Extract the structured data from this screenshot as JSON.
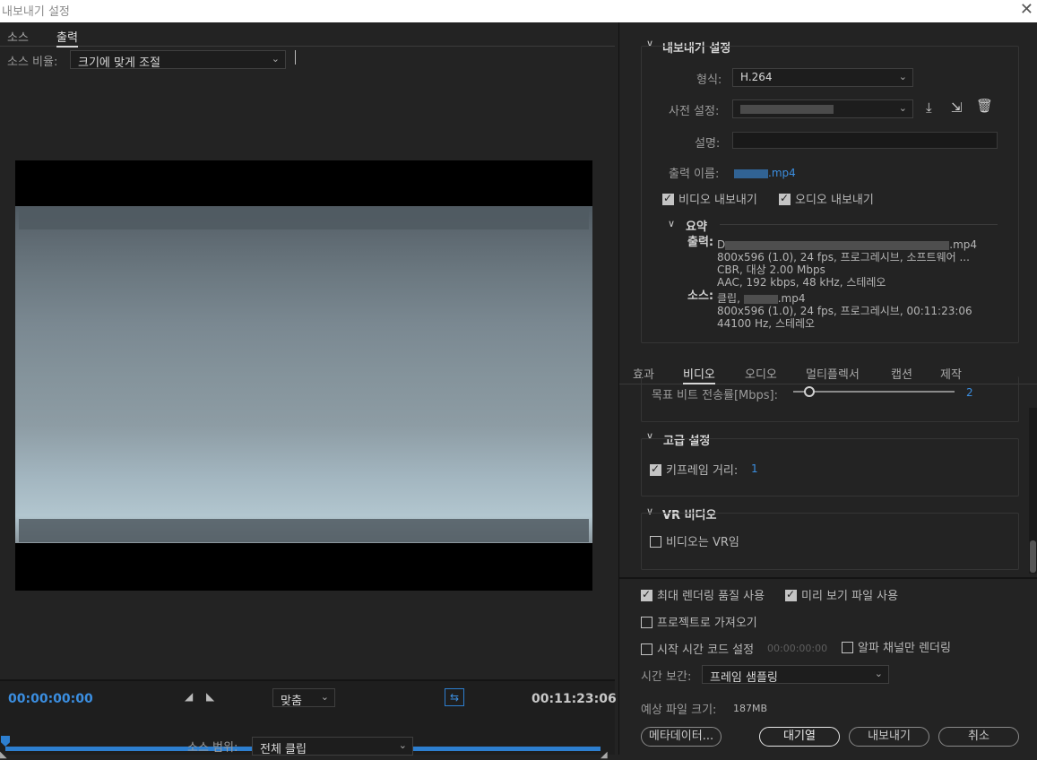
{
  "window": {
    "title": "내보내기 설정"
  },
  "left": {
    "tabs": [
      "소스",
      "출력"
    ],
    "source_scaling_label": "소스 비율:",
    "source_scaling_value": "크기에 맞게 조절",
    "timecode_start": "00:00:00:00",
    "timecode_end": "00:11:23:06",
    "fit_value": "맞춤",
    "source_range_label": "소스 범위:",
    "source_range_value": "전체 클립"
  },
  "export_settings": {
    "header": "내보내기 설정",
    "format_label": "형식:",
    "format_value": "H.264",
    "preset_label": "사전 설정:",
    "comment_label": "설명:",
    "output_name_label": "출력 이름:",
    "output_name_value": ".mp4",
    "export_video_label": "비디오 내보내기",
    "export_audio_label": "오디오 내보내기",
    "summary_header": "요약",
    "output_label": "출력:",
    "output_line1_prefix": "D",
    "output_line1_suffix": ".mp4",
    "output_line2": "800x596 (1.0), 24 fps, 프로그레시브, 소프트웨어 ...",
    "output_line3": "CBR, 대상 2.00 Mbps",
    "output_line4": "AAC, 192 kbps, 48 kHz, 스테레오",
    "source_label": "소스:",
    "source_line1_prefix": "클립, ",
    "source_line1_suffix": ".mp4",
    "source_line2": "800x596 (1.0), 24 fps, 프로그레시브, 00:11:23:06",
    "source_line3": "44100 Hz, 스테레오"
  },
  "settings_tabs": [
    "효과",
    "비디오",
    "오디오",
    "멀티플렉서",
    "캡션",
    "제작"
  ],
  "video": {
    "target_bitrate_label": "목표 비트 전송률[Mbps]:",
    "target_bitrate_value": "2",
    "target_bitrate_level": 0.1,
    "advanced_header": "고급 설정",
    "keyframe_label": "키프레임 거리:",
    "keyframe_value": "1",
    "vr_header": "VR 비디오",
    "vr_checkbox_label": "비디오는 VR임"
  },
  "bottom": {
    "max_render_label": "최대 렌더링 품질 사용",
    "preview_files_label": "미리 보기 파일 사용",
    "import_project_label": "프로젝트로 가져오기",
    "start_timecode_label": "시작 시간 코드 설정",
    "start_timecode_value": "00:00:00:00",
    "alpha_only_label": "알파 채널만 렌더링",
    "time_interp_label": "시간 보간:",
    "time_interp_value": "프레임 샘플링",
    "est_size_label": "예상 파일 크기:",
    "est_size_value": "187MB",
    "metadata_button": "메타데이터...",
    "queue_button": "대기열",
    "export_button": "내보내기",
    "cancel_button": "취소"
  },
  "colors": {
    "accent": "#2d7fd0",
    "link": "#3b8ee0",
    "timecode": "#3b8ee0"
  }
}
